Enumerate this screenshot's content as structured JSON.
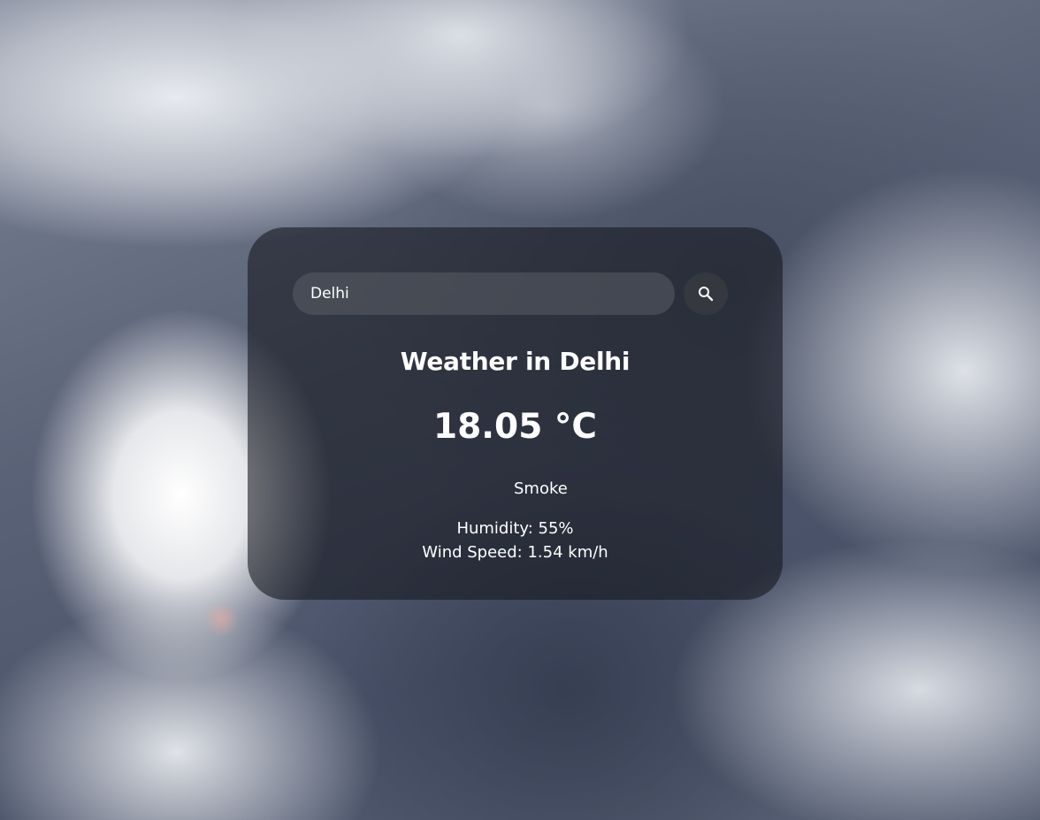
{
  "search": {
    "value": "Delhi",
    "icon": "search-icon"
  },
  "weather": {
    "title": "Weather in Delhi",
    "temperature": "18.05 °C",
    "icon": "weather-condition-icon",
    "description": "Smoke",
    "humidity": "Humidity: 55%",
    "wind_speed": "Wind Speed: 1.54 km/h"
  },
  "colors": {
    "card_background": "#14161e",
    "text": "#ffffff",
    "search_field": "#5a5c64",
    "search_button": "#373940"
  }
}
